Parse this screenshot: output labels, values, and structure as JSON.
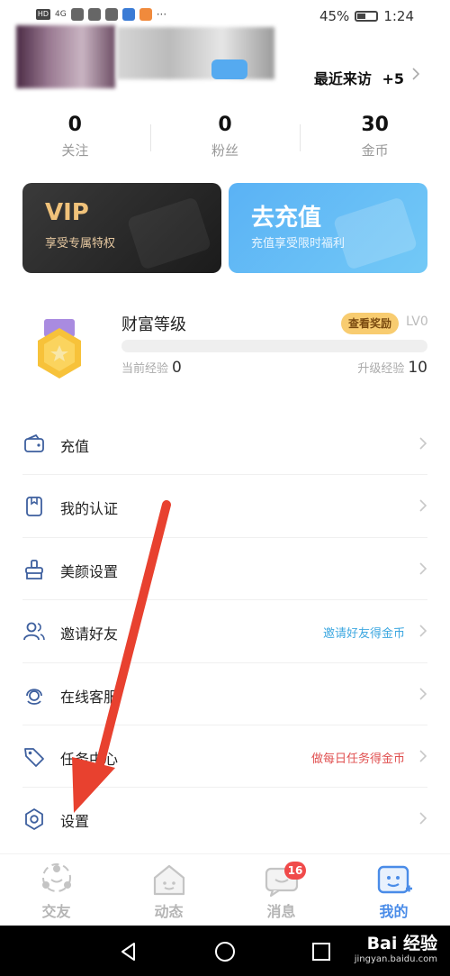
{
  "status_bar": {
    "battery": "45%",
    "time": "1:24",
    "network": "4G",
    "hd": "HD",
    "more": "···"
  },
  "profile": {
    "recent_visits_label": "最近来访",
    "recent_visits_count": "+5"
  },
  "stats": [
    {
      "value": "0",
      "label": "关注"
    },
    {
      "value": "0",
      "label": "粉丝"
    },
    {
      "value": "30",
      "label": "金币"
    }
  ],
  "vip_card": {
    "title": "VIP",
    "subtitle": "享受专属特权"
  },
  "recharge_card": {
    "title": "去充值",
    "subtitle": "充值享受限时福利"
  },
  "wealth": {
    "title": "财富等级",
    "reward_button": "查看奖励",
    "level": "LV0",
    "progress": 0,
    "current_exp_label": "当前经验",
    "current_exp": "0",
    "upgrade_exp_label": "升级经验",
    "upgrade_exp": "10"
  },
  "menu": [
    {
      "label": "充值",
      "icon": "wallet-icon",
      "hint": ""
    },
    {
      "label": "我的认证",
      "icon": "id-badge-icon",
      "hint": ""
    },
    {
      "label": "美颜设置",
      "icon": "beauty-brush-icon",
      "hint": ""
    },
    {
      "label": "邀请好友",
      "icon": "invite-friends-icon",
      "hint": "邀请好友得金币",
      "hint_color": "#3ea8e0"
    },
    {
      "label": "在线客服",
      "icon": "customer-service-icon",
      "hint": ""
    },
    {
      "label": "任务中心",
      "icon": "task-tag-icon",
      "hint": "做每日任务得金币",
      "hint_color": "#e05050"
    },
    {
      "label": "设置",
      "icon": "gear-icon",
      "hint": ""
    }
  ],
  "tabs": [
    {
      "label": "交友",
      "icon": "friends-tab-icon",
      "active": false
    },
    {
      "label": "动态",
      "icon": "moments-tab-icon",
      "active": false
    },
    {
      "label": "消息",
      "icon": "message-tab-icon",
      "active": false,
      "badge": "16"
    },
    {
      "label": "我的",
      "icon": "profile-tab-icon",
      "active": true
    }
  ],
  "watermark": {
    "main": "Bai 经验",
    "sub": "jingyan.baidu.com"
  },
  "colors": {
    "accent": "#4a8ce8",
    "gold": "#f8cc70",
    "annotation_red": "#e8412f"
  }
}
